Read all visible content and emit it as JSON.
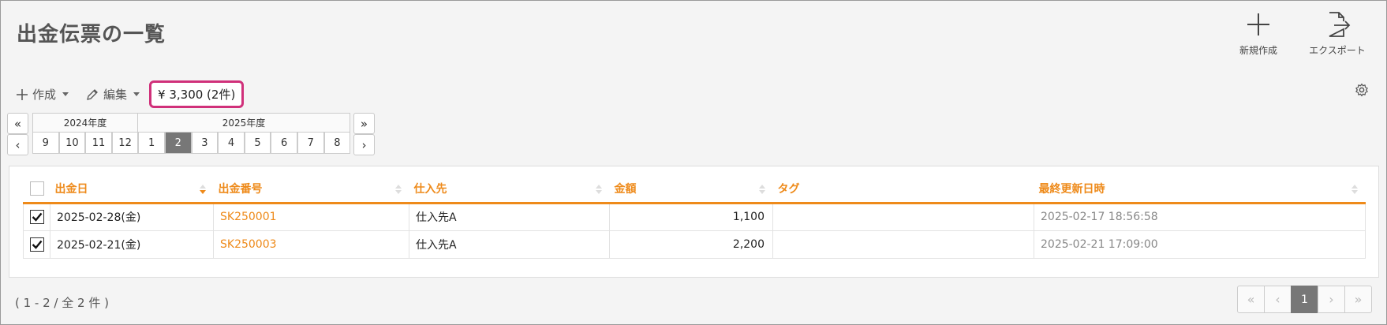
{
  "page": {
    "title": "出金伝票の一覧"
  },
  "top_actions": {
    "new_label": "新規作成",
    "export_label": "エクスポート"
  },
  "toolbar": {
    "create_label": "作成",
    "edit_label": "編集",
    "total_label": "¥ 3,300 (2件)"
  },
  "period_nav": {
    "first_label": "«",
    "prev_label": "‹",
    "next_label": "›",
    "last_label": "»",
    "fiscal_years": [
      {
        "label": "2024年度"
      },
      {
        "label": "2025年度"
      }
    ],
    "months": [
      {
        "label": "9"
      },
      {
        "label": "10"
      },
      {
        "label": "11"
      },
      {
        "label": "12"
      },
      {
        "label": "1"
      },
      {
        "label": "2"
      },
      {
        "label": "3"
      },
      {
        "label": "4"
      },
      {
        "label": "5"
      },
      {
        "label": "6"
      },
      {
        "label": "7"
      },
      {
        "label": "8"
      }
    ],
    "selected_month": "2"
  },
  "table": {
    "columns": [
      {
        "label": "出金日"
      },
      {
        "label": "出金番号"
      },
      {
        "label": "仕入先"
      },
      {
        "label": "金額"
      },
      {
        "label": "タグ"
      },
      {
        "label": "最終更新日時"
      }
    ],
    "rows": [
      {
        "checked": true,
        "date": "2025-02-28(金)",
        "number": "SK250001",
        "supplier": "仕入先A",
        "amount": "1,100",
        "tag": "",
        "updated": "2025-02-17 18:56:58"
      },
      {
        "checked": true,
        "date": "2025-02-21(金)",
        "number": "SK250003",
        "supplier": "仕入先A",
        "amount": "2,200",
        "tag": "",
        "updated": "2025-02-21 17:09:00"
      }
    ]
  },
  "footer": {
    "range_text": "( 1 - 2 / 全 2 件 )"
  },
  "pager": {
    "first": "«",
    "prev": "‹",
    "current": "1",
    "next": "›",
    "last": "»"
  },
  "colors": {
    "accent": "#ee8a1a",
    "highlight_border": "#d0307a",
    "active_gray": "#777777"
  }
}
